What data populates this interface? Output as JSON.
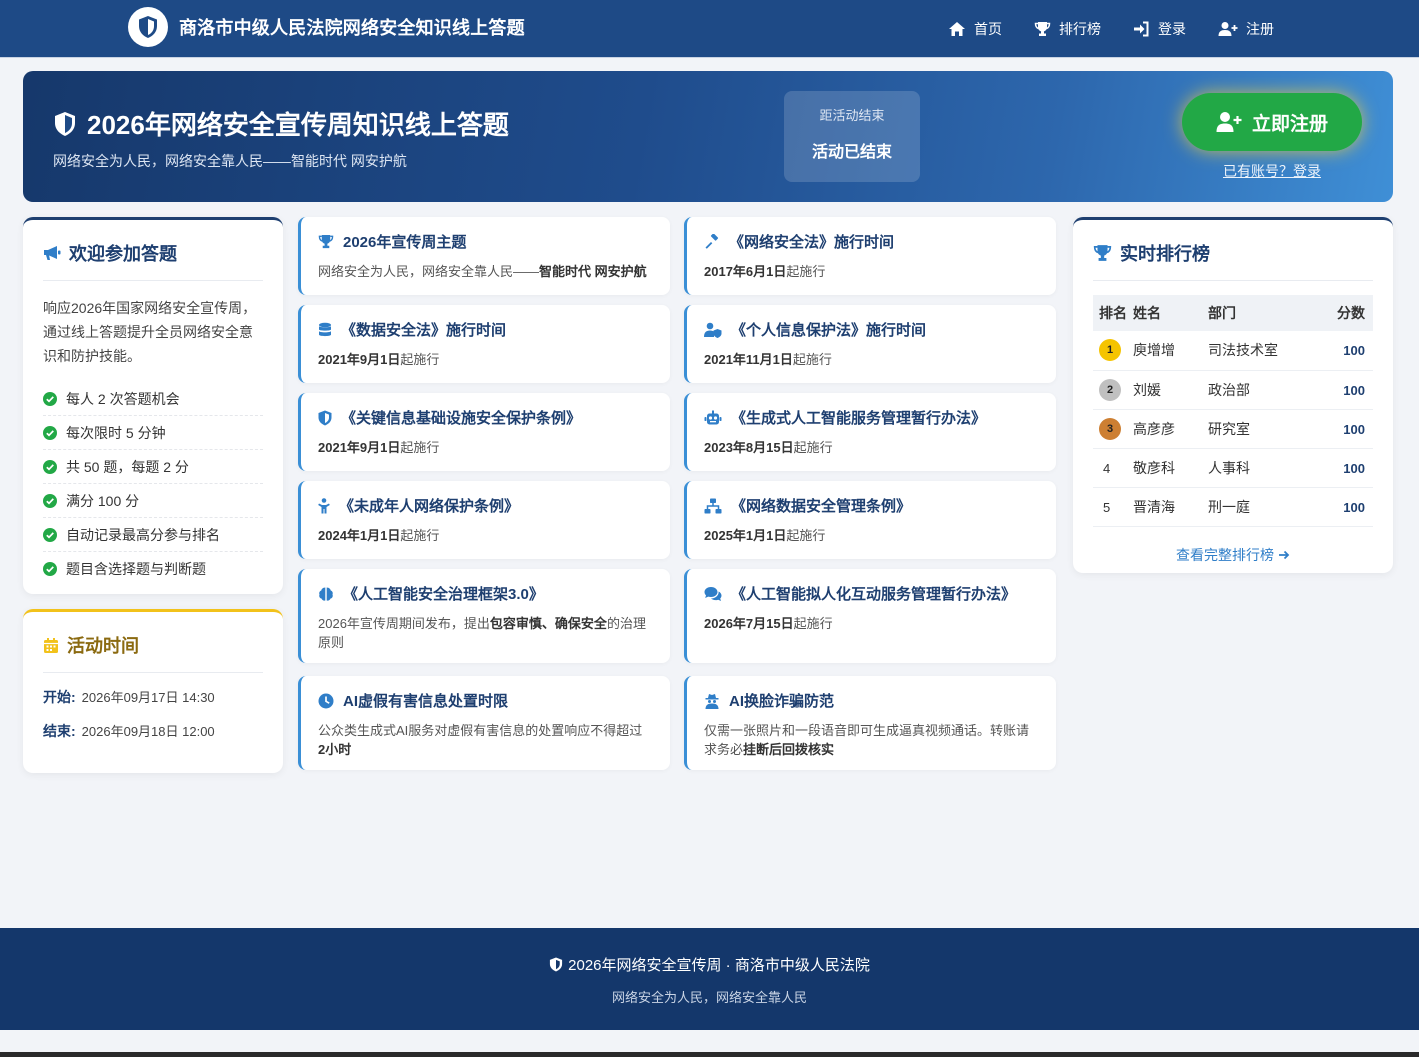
{
  "nav": {
    "brand": "商洛市中级人民法院网络安全知识线上答题",
    "links": [
      {
        "label": "首页",
        "icon": "home-icon"
      },
      {
        "label": "排行榜",
        "icon": "trophy-icon"
      },
      {
        "label": "登录",
        "icon": "sign-in-icon"
      },
      {
        "label": "注册",
        "icon": "user-plus-icon"
      }
    ]
  },
  "hero": {
    "title": "2026年网络安全宣传周知识线上答题",
    "subtitle": "网络安全为人民，网络安全靠人民——智能时代 网安护航",
    "countdown_label": "距活动结束",
    "countdown_status": "活动已结束",
    "register_button": "立即注册",
    "login_link": "已有账号？登录"
  },
  "welcome": {
    "title": "欢迎参加答题",
    "intro": "响应2026年国家网络安全宣传周，通过线上答题提升全员网络安全意识和防护技能。",
    "rules": [
      "每人 2 次答题机会",
      "每次限时 5 分钟",
      "共 50 题，每题 2 分",
      "满分 100 分",
      "自动记录最高分参与排名",
      "题目含选择题与判断题"
    ]
  },
  "activity": {
    "title": "活动时间",
    "start_label": "开始:",
    "start_value": "2026年09月17日 14:30",
    "end_label": "结束:",
    "end_value": "2026年09月18日 12:00"
  },
  "info_cards": [
    {
      "title": "2026年宣传周主题",
      "icon": "trophy-icon",
      "desc_plain": "网络安全为人民，网络安全靠人民——",
      "desc_bold": "智能时代 网安护航",
      "desc_tail": ""
    },
    {
      "title": "《网络安全法》施行时间",
      "icon": "gavel-icon",
      "desc_plain": "",
      "desc_bold": "2017年6月1日",
      "desc_tail": "起施行"
    },
    {
      "title": "《数据安全法》施行时间",
      "icon": "database-icon",
      "desc_plain": "",
      "desc_bold": "2021年9月1日",
      "desc_tail": "起施行"
    },
    {
      "title": "《个人信息保护法》施行时间",
      "icon": "user-shield-icon",
      "desc_plain": "",
      "desc_bold": "2021年11月1日",
      "desc_tail": "起施行"
    },
    {
      "title": "《关键信息基础设施安全保护条例》",
      "icon": "shield-icon",
      "desc_plain": "",
      "desc_bold": "2021年9月1日",
      "desc_tail": "起施行"
    },
    {
      "title": "《生成式人工智能服务管理暂行办法》",
      "icon": "robot-icon",
      "desc_plain": "",
      "desc_bold": "2023年8月15日",
      "desc_tail": "起施行"
    },
    {
      "title": "《未成年人网络保护条例》",
      "icon": "child-icon",
      "desc_plain": "",
      "desc_bold": "2024年1月1日",
      "desc_tail": "起施行"
    },
    {
      "title": "《网络数据安全管理条例》",
      "icon": "sitemap-icon",
      "desc_plain": "",
      "desc_bold": "2025年1月1日",
      "desc_tail": "起施行"
    },
    {
      "title": "《人工智能安全治理框架3.0》",
      "icon": "brain-icon",
      "desc_plain": "2026年宣传周期间发布，提出",
      "desc_bold": "包容审慎、确保安全",
      "desc_tail": "的治理原则"
    },
    {
      "title": "《人工智能拟人化互动服务管理暂行办法》",
      "icon": "comments-icon",
      "desc_plain": "",
      "desc_bold": "2026年7月15日",
      "desc_tail": "起施行"
    },
    {
      "title": "AI虚假有害信息处置时限",
      "icon": "clock-icon",
      "desc_plain": "公众类生成式AI服务对虚假有害信息的处置响应不得超过 ",
      "desc_bold": "2小时",
      "desc_tail": ""
    },
    {
      "title": "AI换脸诈骗防范",
      "icon": "user-secret-icon",
      "desc_plain": "仅需一张照片和一段语音即可生成逼真视频通话。转账请求务必",
      "desc_bold": "挂断后回拨核实",
      "desc_tail": ""
    }
  ],
  "ranking": {
    "title": "实时排行榜",
    "headers": [
      "排名",
      "姓名",
      "部门",
      "分数"
    ],
    "rows": [
      {
        "rank": "1",
        "name": "庾增增",
        "dept": "司法技术室",
        "score": "100"
      },
      {
        "rank": "2",
        "name": "刘媛",
        "dept": "政治部",
        "score": "100"
      },
      {
        "rank": "3",
        "name": "高彦彦",
        "dept": "研究室",
        "score": "100"
      },
      {
        "rank": "4",
        "name": "敬彦科",
        "dept": "人事科",
        "score": "100"
      },
      {
        "rank": "5",
        "name": "晋清海",
        "dept": "刑一庭",
        "score": "100"
      }
    ],
    "more_link": "查看完整排行榜"
  },
  "footer": {
    "title": "2026年网络安全宣传周 · 商洛市中级人民法院",
    "subtitle": "网络安全为人民，网络安全靠人民"
  },
  "colors": {
    "nav_bg": "#1e4a86",
    "primary": "#1e3f70",
    "accent_blue": "#3a8fd6",
    "success_green": "#22a846",
    "gold": "#f2c21b",
    "medal_gold": "#f5c400",
    "medal_silver": "#c0c0c0",
    "medal_bronze": "#cd7f32"
  }
}
